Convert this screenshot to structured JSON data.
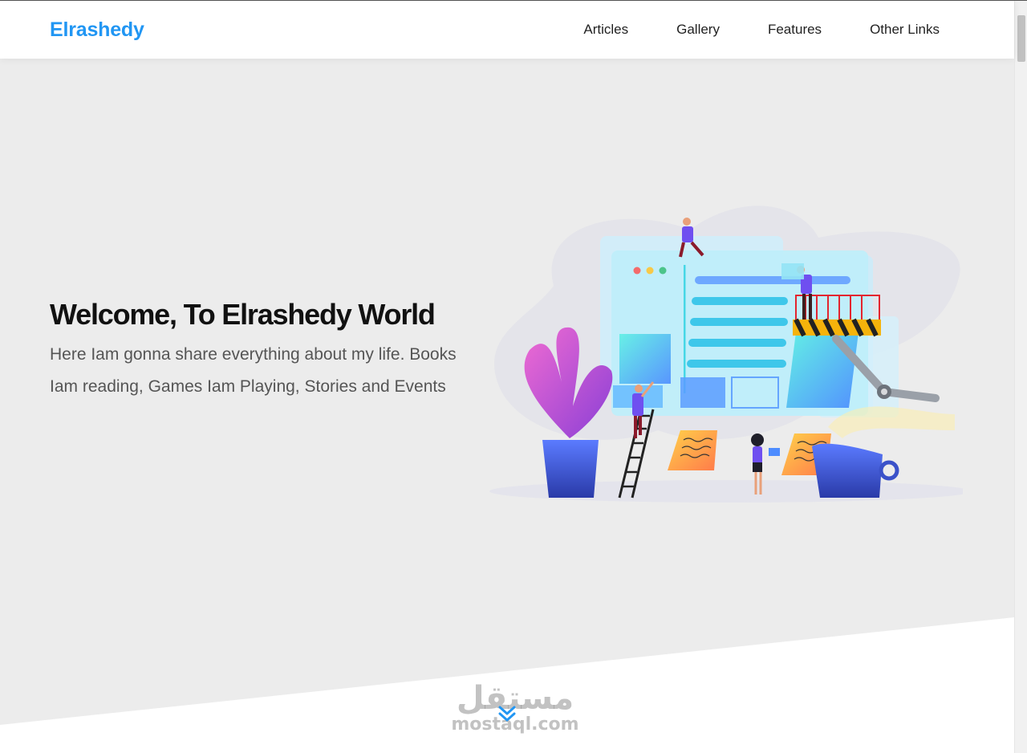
{
  "header": {
    "logo": "Elrashedy",
    "nav": [
      {
        "label": "Articles"
      },
      {
        "label": "Gallery"
      },
      {
        "label": "Features"
      },
      {
        "label": "Other Links"
      }
    ]
  },
  "hero": {
    "title": "Welcome, To Elrashedy World",
    "description": "Here Iam gonna share everything about my life. Books Iam reading, Games Iam Playing, Stories and Events"
  },
  "watermark": {
    "arabic": "مستقل",
    "latin": "mostaql.com"
  },
  "colors": {
    "brand": "#2196f3",
    "hero_bg": "#ececec",
    "text_dark": "#111111",
    "text_muted": "#555555"
  },
  "icons": {
    "scroll_down": "double-chevron-down-icon"
  }
}
